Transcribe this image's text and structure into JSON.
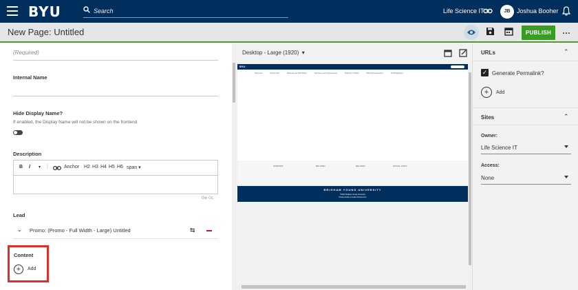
{
  "topnav": {
    "logo": "BYU",
    "search_placeholder": "Search",
    "site_name": "Life Science IT",
    "user_initials": "JB",
    "user_name": "Joshua Booher"
  },
  "titlebar": {
    "page_title": "New Page: Untitled",
    "publish_label": "PUBLISH",
    "more_label": "…"
  },
  "form": {
    "required_hint": "(Required)",
    "internal_name_label": "Internal Name",
    "hide_display_label": "Hide Display Name?",
    "hide_display_help": "If enabled, the Display Name will not be shown on the frontend",
    "hide_display_enabled": false,
    "description_label": "Description",
    "toolbar": {
      "bold": "B",
      "italic": "I",
      "anchor": "Anchor",
      "headings": [
        "H2",
        "H3",
        "H4",
        "H5",
        "H6"
      ],
      "span": "span"
    },
    "word_count": "0w 0c",
    "lead_label": "Lead",
    "lead_item": "Promo: (Promo - Full Width - Large) Untitled",
    "content_label": "Content",
    "add_label": "Add"
  },
  "preview": {
    "device": "Desktop - Large (1920)",
    "mini_logo": "BYU",
    "mini_nav": [
      "Services",
      "Personnel",
      "Request an Exhibition",
      "Service Level Agreement",
      "Submit a Ticket",
      "Web Development",
      "LS Brightspot"
    ],
    "footer_cols": [
      "SUPPORT",
      "RELATED",
      "RELATED",
      "SOCIAL LINKS"
    ],
    "footer_bar_title": "BRIGHAM YOUNG UNIVERSITY",
    "footer_bar_line1": "©2021 Brigham Young University",
    "footer_bar_line2": "Privacy Notice | Cookie Preferences"
  },
  "sidebar": {
    "urls_title": "URLs",
    "generate_permalink_label": "Generate Permalink?",
    "generate_permalink_checked": true,
    "add_label": "Add",
    "sites_title": "Sites",
    "owner_label": "Owner:",
    "owner_value": "Life Science IT",
    "access_label": "Access:",
    "access_value": "None"
  },
  "colors": {
    "nav_bg": "#002e5d",
    "publish_bg": "#3a9d23",
    "highlight": "#e32b2b",
    "remove": "#c8102e"
  }
}
